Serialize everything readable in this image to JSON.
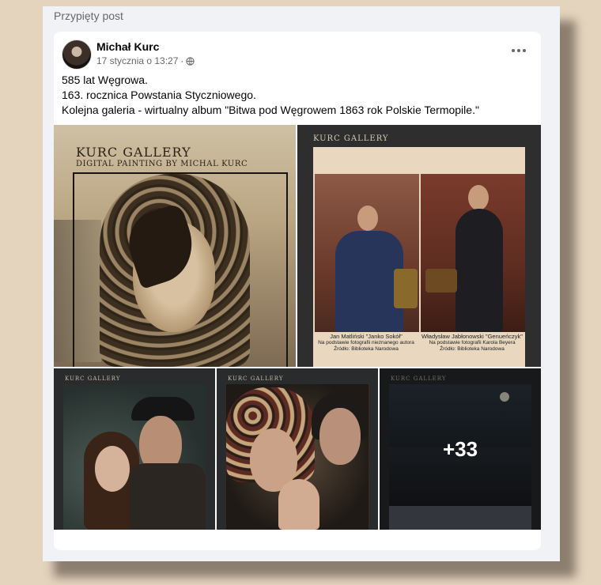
{
  "header": {
    "pinned_label": "Przypięty post"
  },
  "post": {
    "author": "Michał Kurc",
    "date": "17 stycznia o 13:27",
    "separator": "·",
    "privacy_icon": "globe-icon",
    "menu_icon": "more-horizontal-icon",
    "lines": [
      "585 lat Węgrowa.",
      "163. rocznica Powstania Styczniowego.",
      "Kolejna galeria - wirtualny album \"Bitwa pod Węgrowem 1863 rok Polskie Termopile.\""
    ]
  },
  "gallery": {
    "tile1": {
      "title": "KURC GALLERY",
      "subtitle": "DIGITAL PAINTING BY MICHAL KURC"
    },
    "tile2": {
      "title": "KURC GALLERY",
      "left": {
        "name": "Jan Matliński \"Janko Sokół\"",
        "source": "Na podstawie fotografii nieznanego autora",
        "archive": "Źródło: Biblioteka Narodowa"
      },
      "right": {
        "name": "Władysław Jabłonowski \"Genueńczyk\"",
        "source": "Na podstawie fotografii Karola Beyera",
        "archive": "Źródło: Biblioteka Narodowa"
      }
    },
    "tile3": {
      "title": "KURC GALLERY"
    },
    "tile4": {
      "title": "KURC GALLERY"
    },
    "tile5": {
      "title": "KURC GALLERY",
      "more_count": "+33"
    }
  },
  "colors": {
    "page_bg": "#e4d3bd",
    "card_bg": "#ffffff",
    "text": "#050505",
    "muted": "#65676b"
  }
}
